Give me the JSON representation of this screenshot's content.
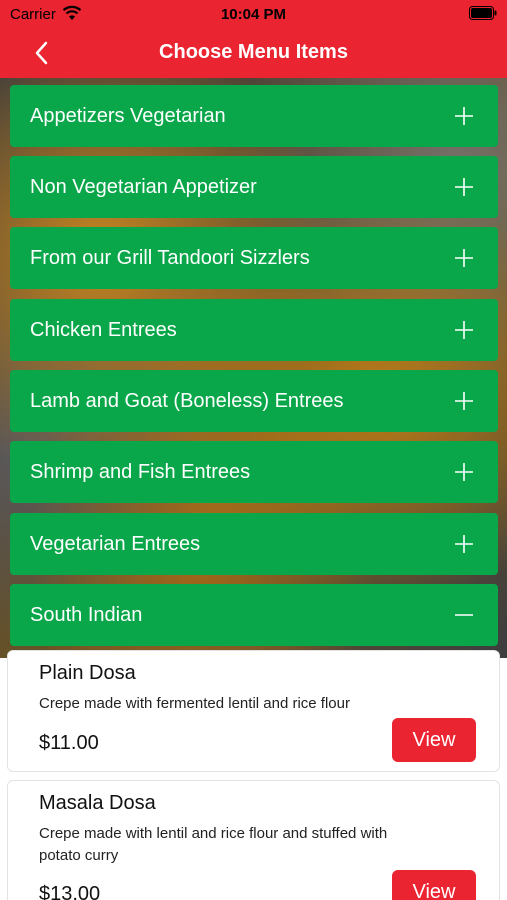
{
  "status_bar": {
    "carrier": "Carrier",
    "time": "10:04 PM"
  },
  "nav": {
    "title": "Choose Menu Items",
    "back_icon": "chevron-left-icon"
  },
  "colors": {
    "brand_red": "#ea2430",
    "category_green": "#0aa74a"
  },
  "categories": [
    {
      "label": "Appetizers Vegetarian",
      "icon": "plus-icon"
    },
    {
      "label": "Non Vegetarian Appetizer",
      "icon": "plus-icon"
    },
    {
      "label": "From our Grill Tandoori Sizzlers",
      "icon": "plus-icon"
    },
    {
      "label": "Chicken Entrees",
      "icon": "plus-icon"
    },
    {
      "label": "Lamb and Goat (Boneless) Entrees",
      "icon": "plus-icon"
    },
    {
      "label": "Shrimp and Fish Entrees",
      "icon": "plus-icon"
    },
    {
      "label": "Vegetarian Entrees",
      "icon": "plus-icon"
    },
    {
      "label": "South Indian",
      "icon": "minus-icon",
      "expanded": true
    }
  ],
  "items": [
    {
      "name": "Plain Dosa",
      "description": "Crepe made with fermented lentil and rice flour",
      "price": "$11.00",
      "button": "View"
    },
    {
      "name": "Masala Dosa",
      "description": "Crepe made with lentil and rice flour and stuffed with potato curry",
      "price": "$13.00",
      "button": "View"
    }
  ]
}
